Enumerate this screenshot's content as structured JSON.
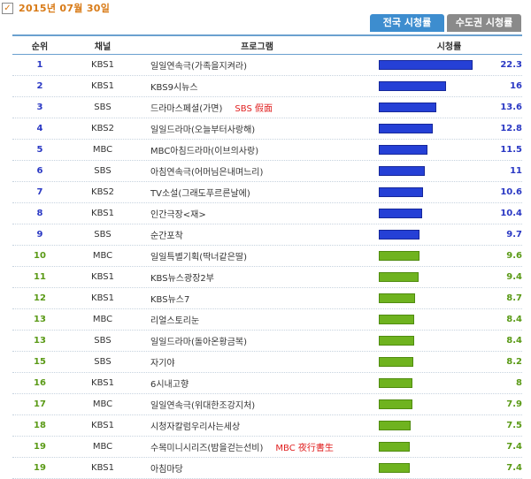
{
  "header": {
    "date": "2015년 07월 30일",
    "check_glyph": "✓"
  },
  "tabs": [
    {
      "label": "전국 시청률",
      "active": true
    },
    {
      "label": "수도권 시청률",
      "active": false
    }
  ],
  "table": {
    "columns": [
      "순위",
      "채널",
      "프로그램",
      "시청률"
    ],
    "max_rating": 22.3,
    "rows": [
      {
        "rank": "1",
        "channel": "KBS1",
        "program": "일일연속극(가족을지켜라)",
        "tag": "",
        "rating": 22.3,
        "rating_text": "22.3",
        "color": "blue"
      },
      {
        "rank": "2",
        "channel": "KBS1",
        "program": "KBS9시뉴스",
        "tag": "",
        "rating": 16,
        "rating_text": "16",
        "color": "blue"
      },
      {
        "rank": "3",
        "channel": "SBS",
        "program": "드라마스페셜(가면)",
        "tag": "SBS 假面",
        "rating": 13.6,
        "rating_text": "13.6",
        "color": "blue"
      },
      {
        "rank": "4",
        "channel": "KBS2",
        "program": "일일드라마(오늘부터사랑해)",
        "tag": "",
        "rating": 12.8,
        "rating_text": "12.8",
        "color": "blue"
      },
      {
        "rank": "5",
        "channel": "MBC",
        "program": "MBC아침드라마(이브의사랑)",
        "tag": "",
        "rating": 11.5,
        "rating_text": "11.5",
        "color": "blue"
      },
      {
        "rank": "6",
        "channel": "SBS",
        "program": "아침연속극(어머님은내며느리)",
        "tag": "",
        "rating": 11,
        "rating_text": "11",
        "color": "blue"
      },
      {
        "rank": "7",
        "channel": "KBS2",
        "program": "TV소설(그래도푸르른날에)",
        "tag": "",
        "rating": 10.6,
        "rating_text": "10.6",
        "color": "blue"
      },
      {
        "rank": "8",
        "channel": "KBS1",
        "program": "인간극장<재>",
        "tag": "",
        "rating": 10.4,
        "rating_text": "10.4",
        "color": "blue"
      },
      {
        "rank": "9",
        "channel": "SBS",
        "program": "순간포착",
        "tag": "",
        "rating": 9.7,
        "rating_text": "9.7",
        "color": "blue"
      },
      {
        "rank": "10",
        "channel": "MBC",
        "program": "일일특별기획(딱너같은딸)",
        "tag": "",
        "rating": 9.6,
        "rating_text": "9.6",
        "color": "green"
      },
      {
        "rank": "11",
        "channel": "KBS1",
        "program": "KBS뉴스광장2부",
        "tag": "",
        "rating": 9.4,
        "rating_text": "9.4",
        "color": "green"
      },
      {
        "rank": "12",
        "channel": "KBS1",
        "program": "KBS뉴스7",
        "tag": "",
        "rating": 8.7,
        "rating_text": "8.7",
        "color": "green"
      },
      {
        "rank": "13",
        "channel": "MBC",
        "program": "리얼스토리눈",
        "tag": "",
        "rating": 8.4,
        "rating_text": "8.4",
        "color": "green"
      },
      {
        "rank": "13",
        "channel": "SBS",
        "program": "일일드라마(돌아온황금복)",
        "tag": "",
        "rating": 8.4,
        "rating_text": "8.4",
        "color": "green"
      },
      {
        "rank": "15",
        "channel": "SBS",
        "program": "자기야",
        "tag": "",
        "rating": 8.2,
        "rating_text": "8.2",
        "color": "green"
      },
      {
        "rank": "16",
        "channel": "KBS1",
        "program": "6시내고향",
        "tag": "",
        "rating": 8,
        "rating_text": "8",
        "color": "green"
      },
      {
        "rank": "17",
        "channel": "MBC",
        "program": "일일연속극(위대한조강지처)",
        "tag": "",
        "rating": 7.9,
        "rating_text": "7.9",
        "color": "green"
      },
      {
        "rank": "18",
        "channel": "KBS1",
        "program": "시청자칼럼우리사는세상",
        "tag": "",
        "rating": 7.5,
        "rating_text": "7.5",
        "color": "green"
      },
      {
        "rank": "19",
        "channel": "MBC",
        "program": "수목미니시리즈(밤을걷는선비)",
        "tag": "MBC 夜行書生",
        "rating": 7.4,
        "rating_text": "7.4",
        "color": "green"
      },
      {
        "rank": "19",
        "channel": "KBS1",
        "program": "아침마당",
        "tag": "",
        "rating": 7.4,
        "rating_text": "7.4",
        "color": "green"
      }
    ]
  },
  "colors": {
    "accent_blue": "#3d8dcf",
    "rank_blue": "#2a38c4",
    "rank_green": "#5a9a16",
    "bar_blue": "#2540d6",
    "bar_green": "#6fb31f",
    "date_orange": "#d87a16",
    "tag_red": "#e02020"
  }
}
